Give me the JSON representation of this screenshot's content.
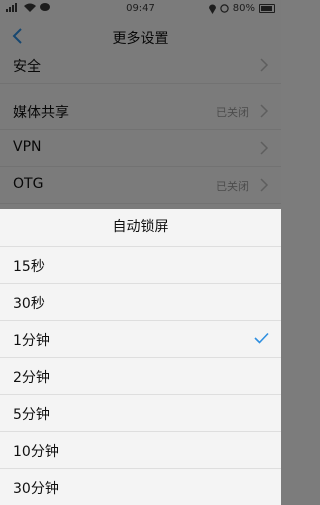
{
  "status_bar": {
    "time": "09:47",
    "battery": "80%",
    "icons": [
      "signal-icon",
      "wifi-icon",
      "message-icon",
      "location-icon",
      "alarm-icon",
      "battery-icon"
    ]
  },
  "header": {
    "title": "更多设置",
    "back_icon": "chevron-left-icon"
  },
  "settings": [
    {
      "label": "安全",
      "value": ""
    },
    {
      "label": "媒体共享",
      "value": "已关闭"
    },
    {
      "label": "VPN",
      "value": ""
    },
    {
      "label": "OTG",
      "value": "已关闭"
    }
  ],
  "sheet": {
    "title": "自动锁屏",
    "options": [
      "15秒",
      "30秒",
      "1分钟",
      "2分钟",
      "5分钟",
      "10分钟",
      "30分钟"
    ],
    "selected": "1分钟",
    "check_color": "#2f8fe0"
  }
}
